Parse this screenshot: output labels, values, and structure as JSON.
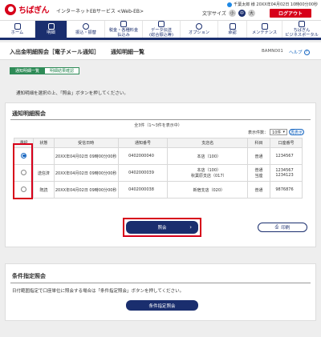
{
  "header": {
    "logo_text": "ちばぎん",
    "service_name": "インターネットEBサービス <Web-EB>",
    "user_line": "千葉太郎 様 20XX年04月02日 10時00分00秒",
    "font_size_label": "文字サイズ",
    "font_sizes": [
      "小",
      "中",
      "大"
    ],
    "logout_label": "ログアウト"
  },
  "gnav": {
    "items": [
      {
        "label": "ホーム"
      },
      {
        "label": "明細"
      },
      {
        "label": "振込・振替"
      },
      {
        "label": "税金・各種料金\n払込み"
      },
      {
        "label": "データ伝送\n(総合振込等)"
      },
      {
        "label": "オプション"
      },
      {
        "label": "承認"
      },
      {
        "label": "メンテナンス"
      },
      {
        "label": "ちばぎん\nビジネスポータル"
      }
    ]
  },
  "page": {
    "title_main": "入出金明細照会［電子メール通知］",
    "title_sub": "通知明細一覧",
    "screen_id": "BAMN001",
    "help_label": "ヘルプ",
    "steps": [
      "通知明細一覧",
      "明細結果確認"
    ],
    "instruction": "通知明細を選択の上、「照会」ボタンを押してください。"
  },
  "list": {
    "title": "通知明細照会",
    "count_text": "全3件（1〜3件を表示中）",
    "perpage_label": "表示件数：",
    "perpage_value": "10件",
    "redisplay_label": "再表示",
    "columns": [
      "選択",
      "状態",
      "受信日時",
      "通知番号",
      "支店名",
      "科目",
      "口座番号"
    ],
    "rows": [
      {
        "selected": true,
        "status": "",
        "received": "20XX年04月02日 09時00分00秒",
        "number": "0402000040",
        "branches": [
          "本店（100）"
        ],
        "types": [
          "普通"
        ],
        "accounts": [
          "1234567"
        ]
      },
      {
        "selected": false,
        "status": "送信済",
        "received": "20XX年04月02日 09時00分00秒",
        "number": "0402000039",
        "branches": [
          "本店（100）",
          "秋葉原支店（017）"
        ],
        "types": [
          "普通",
          "当座"
        ],
        "accounts": [
          "1234567",
          "1234123"
        ]
      },
      {
        "selected": false,
        "status": "既読",
        "received": "20XX年04月02日 09時00分00秒",
        "number": "0402000038",
        "branches": [
          "新宿支店（020）"
        ],
        "types": [
          "普通"
        ],
        "accounts": [
          "9876876"
        ]
      }
    ],
    "inquiry_label": "照会",
    "print_label": "印刷"
  },
  "condition": {
    "title": "条件指定照会",
    "instruction": "日付範囲指定で口座単位に照会する場合は「条件指定照会」ボタンを押してください。",
    "button_label": "条件指定照会"
  },
  "colors": {
    "navy": "#1a2e6e",
    "brand_red": "#d7001a",
    "step_green": "#2e8b57",
    "highlight_red": "#d7001a"
  }
}
